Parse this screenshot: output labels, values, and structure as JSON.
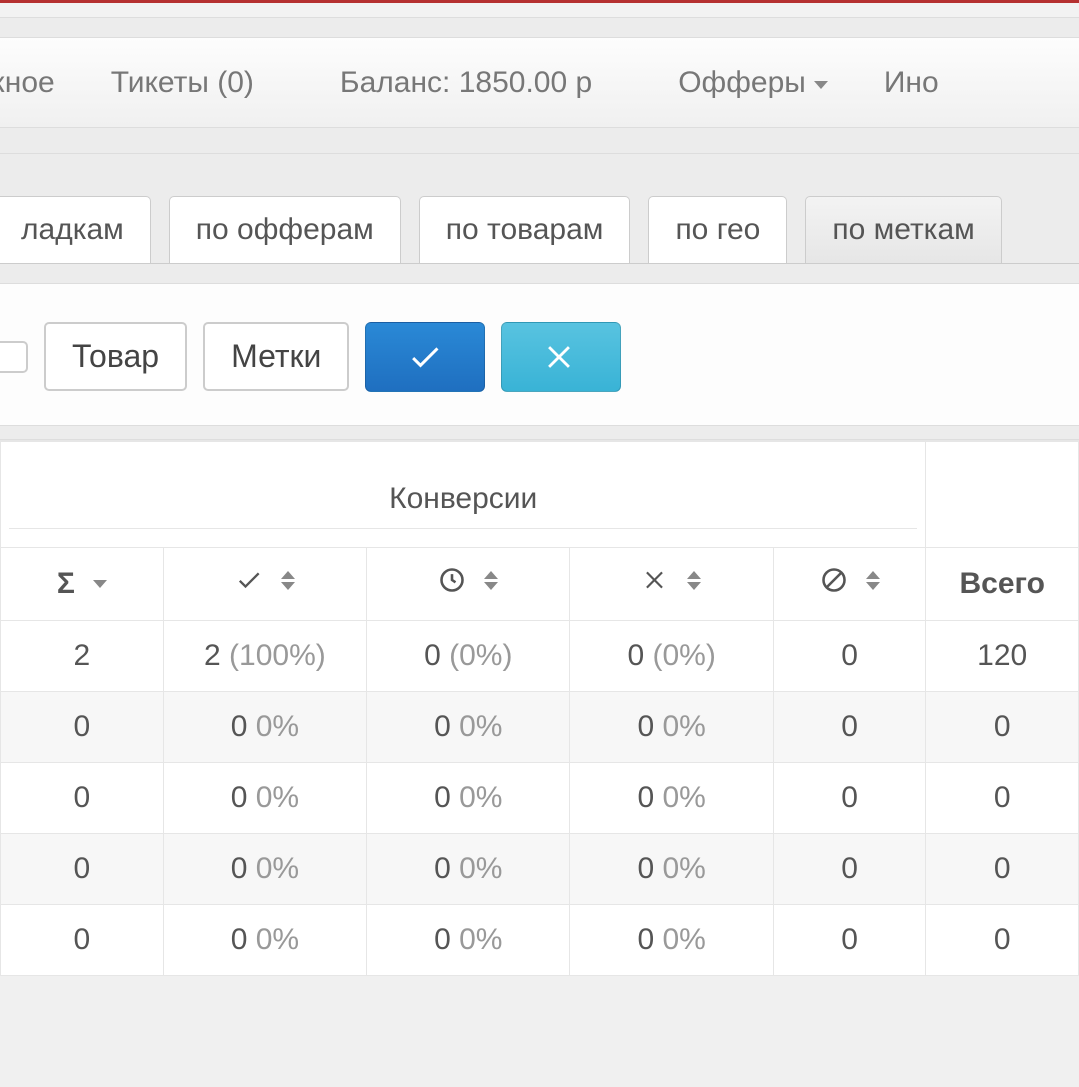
{
  "nav": {
    "item0": "ажное",
    "tickets": "Тикеты (0)",
    "balance": "Баланс: 1850.00 р",
    "offers": "Офферы",
    "more": "Ино"
  },
  "tabs": {
    "t0": "ладкам",
    "t1": "по офферам",
    "t2": "по товарам",
    "t3": "по гео",
    "t4": "по меткам"
  },
  "filters": {
    "cut": "",
    "product": "Товар",
    "labels": "Метки"
  },
  "table": {
    "group_label": "Конверсии",
    "headers": {
      "sum": "Σ",
      "approved_icon": "check",
      "pending_icon": "clock",
      "rejected_icon": "cross",
      "cancelled_icon": "ban",
      "total": "Всего"
    },
    "rows": [
      {
        "sum": "2",
        "approved_val": "2",
        "approved_pct": "(100%)",
        "pending_val": "0",
        "pending_pct": "(0%)",
        "rejected_val": "0",
        "rejected_pct": "(0%)",
        "cancelled": "0",
        "total": "120"
      },
      {
        "sum": "0",
        "approved_val": "0",
        "approved_pct": "0%",
        "pending_val": "0",
        "pending_pct": "0%",
        "rejected_val": "0",
        "rejected_pct": "0%",
        "cancelled": "0",
        "total": "0"
      },
      {
        "sum": "0",
        "approved_val": "0",
        "approved_pct": "0%",
        "pending_val": "0",
        "pending_pct": "0%",
        "rejected_val": "0",
        "rejected_pct": "0%",
        "cancelled": "0",
        "total": "0"
      },
      {
        "sum": "0",
        "approved_val": "0",
        "approved_pct": "0%",
        "pending_val": "0",
        "pending_pct": "0%",
        "rejected_val": "0",
        "rejected_pct": "0%",
        "cancelled": "0",
        "total": "0"
      },
      {
        "sum": "0",
        "approved_val": "0",
        "approved_pct": "0%",
        "pending_val": "0",
        "pending_pct": "0%",
        "rejected_val": "0",
        "rejected_pct": "0%",
        "cancelled": "0",
        "total": "0"
      }
    ]
  }
}
